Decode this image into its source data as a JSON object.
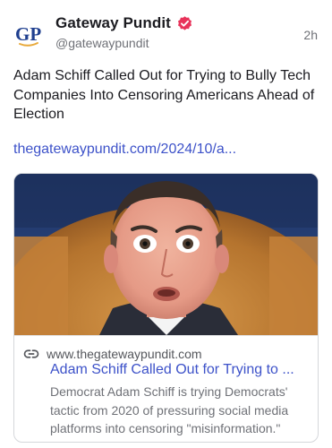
{
  "post": {
    "avatar_text": "GP",
    "display_name": "Gateway Pundit",
    "verified": true,
    "verified_color": "#e8335a",
    "handle": "@gatewaypundit",
    "timestamp": "2h",
    "text": "Adam Schiff Called Out for Trying to Bully Tech Companies Into Censoring Americans Ahead of Election",
    "link": "thegatewaypundit.com/2024/10/a..."
  },
  "card": {
    "image_subject": "portrait photo of a man in a suit",
    "link_icon": "link-icon",
    "domain": "www.thegatewaypundit.com",
    "title": "Adam Schiff Called Out for Trying to ...",
    "description": "Democrat Adam Schiff is trying Democrats' tactic from 2020 of pressuring social media platforms into censoring \"misinformation.\""
  },
  "colors": {
    "link": "#3d52c9",
    "secondary_text": "#6f7177",
    "primary_text": "#1b1b20"
  }
}
